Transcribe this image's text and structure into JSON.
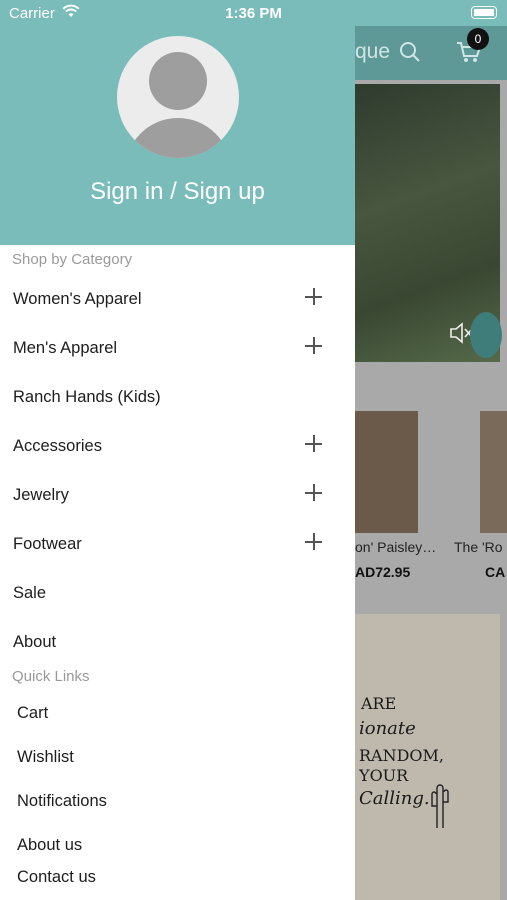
{
  "status_bar": {
    "carrier": "Carrier",
    "time": "1:36 PM"
  },
  "background": {
    "header_title": "que",
    "cart_count": "0",
    "products": [
      {
        "name": "on' Paisley…",
        "price": "AD72.95"
      },
      {
        "name": "The 'Ro",
        "price": "CA"
      }
    ],
    "quote_lines": [
      "ARE",
      "ionate",
      "RANDOM,",
      "YOUR",
      "Calling."
    ]
  },
  "drawer": {
    "sign_in_label": "Sign in / Sign up",
    "shop_section_title": "Shop by Category",
    "categories": [
      {
        "label": "Women's Apparel",
        "expandable": true
      },
      {
        "label": "Men's Apparel",
        "expandable": true
      },
      {
        "label": "Ranch Hands (Kids)",
        "expandable": false
      },
      {
        "label": "Accessories",
        "expandable": true
      },
      {
        "label": "Jewelry",
        "expandable": true
      },
      {
        "label": "Footwear",
        "expandable": true
      },
      {
        "label": "Sale",
        "expandable": false
      },
      {
        "label": "About",
        "expandable": false
      }
    ],
    "quick_section_title": "Quick Links",
    "quick_links": [
      {
        "label": "Cart"
      },
      {
        "label": "Wishlist"
      },
      {
        "label": "Notifications"
      },
      {
        "label": "About us"
      },
      {
        "label": "Contact us"
      }
    ]
  },
  "colors": {
    "accent": "#79bcba",
    "header_dim": "#5e9998"
  }
}
